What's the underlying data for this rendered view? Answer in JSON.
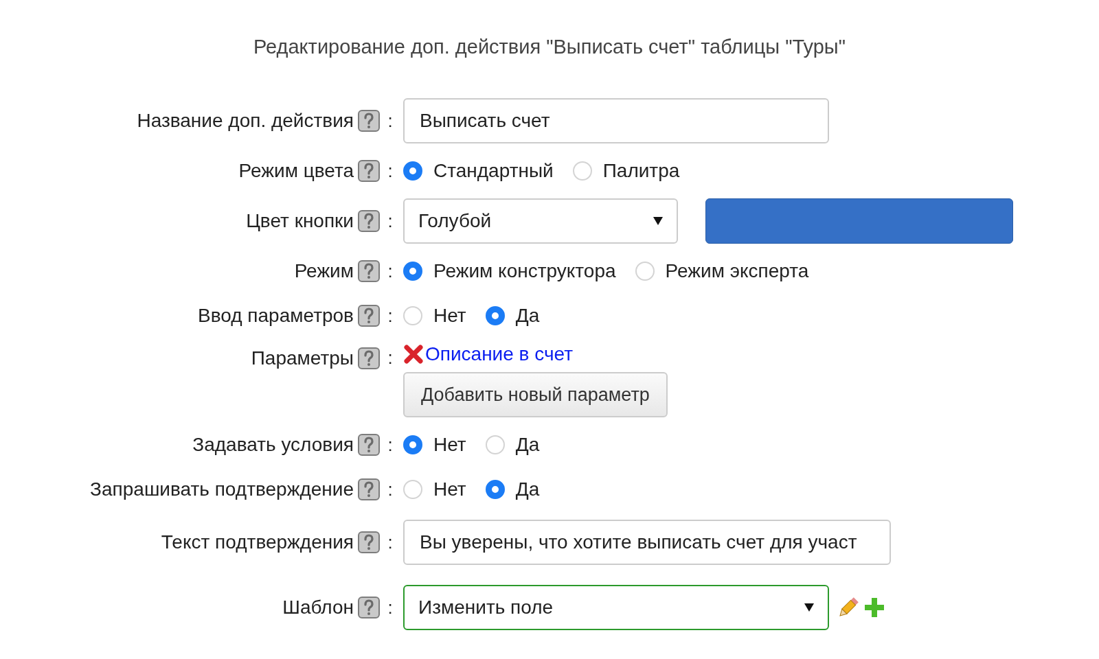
{
  "title": "Редактирование доп. действия \"Выписать счет\" таблицы \"Туры\"",
  "separator": ":",
  "rows": [
    {
      "kind": "text",
      "label": "Название доп. действия",
      "value": "Выписать счет",
      "wide": false
    },
    {
      "kind": "radio",
      "label": "Режим цвета",
      "options": [
        {
          "label": "Стандартный",
          "selected": true
        },
        {
          "label": "Палитра",
          "selected": false
        }
      ]
    },
    {
      "kind": "select",
      "label": "Цвет кнопки",
      "value": "Голубой",
      "color": "#3570c6"
    },
    {
      "kind": "radio",
      "label": "Режим",
      "options": [
        {
          "label": "Режим конструктора",
          "selected": true
        },
        {
          "label": "Режим эксперта",
          "selected": false
        }
      ]
    },
    {
      "kind": "radio",
      "label": "Ввод параметров",
      "options": [
        {
          "label": "Нет",
          "selected": false
        },
        {
          "label": "Да",
          "selected": true
        }
      ]
    },
    {
      "kind": "params",
      "label": "Параметры",
      "items": [
        "Описание в счет"
      ],
      "button": "Добавить новый параметр"
    },
    {
      "kind": "radio",
      "label": "Задавать условия",
      "options": [
        {
          "label": "Нет",
          "selected": true
        },
        {
          "label": "Да",
          "selected": false
        }
      ]
    },
    {
      "kind": "radio",
      "label": "Запрашивать подтверждение",
      "options": [
        {
          "label": "Нет",
          "selected": false
        },
        {
          "label": "Да",
          "selected": true
        }
      ]
    },
    {
      "kind": "text",
      "label": "Текст подтверждения",
      "value": "Вы уверены, что хотите выписать счет для участ",
      "wide": true
    },
    {
      "kind": "template",
      "label": "Шаблон",
      "value": "Изменить поле",
      "focused": true
    }
  ]
}
